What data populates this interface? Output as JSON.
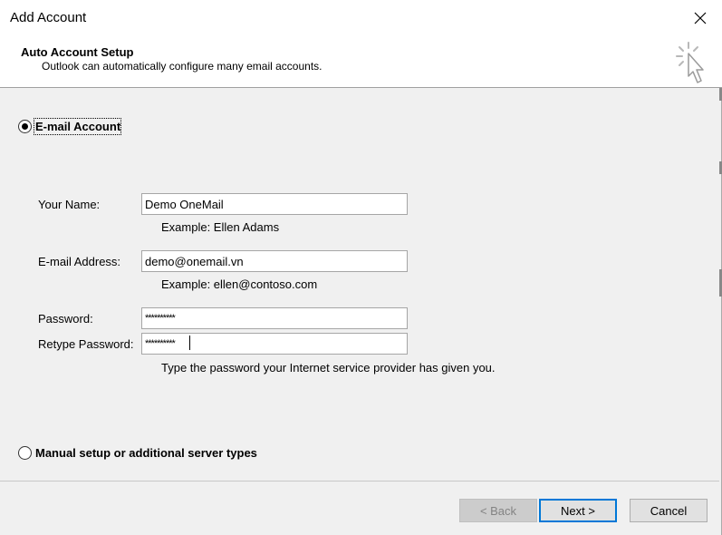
{
  "window": {
    "title": "Add Account",
    "close_icon": "close-icon"
  },
  "header": {
    "title": "Auto Account Setup",
    "subtitle": "Outlook can automatically configure many email accounts.",
    "icon": "wizard-cursor-icon"
  },
  "email_account": {
    "label": "E-mail Account",
    "selected": true,
    "fields": {
      "name": {
        "label": "Your Name:",
        "value": "Demo OneMail",
        "hint": "Example: Ellen Adams"
      },
      "email": {
        "label": "E-mail Address:",
        "value": "demo@onemail.vn",
        "hint": "Example: ellen@contoso.com"
      },
      "password": {
        "label": "Password:",
        "value": "**********"
      },
      "retype_password": {
        "label": "Retype Password:",
        "value": "**********"
      },
      "password_hint": "Type the password your Internet service provider has given you."
    }
  },
  "manual_setup": {
    "label": "Manual setup or additional server types",
    "selected": false
  },
  "buttons": {
    "back": "< Back",
    "next": "Next >",
    "cancel": "Cancel"
  },
  "colors": {
    "accent": "#0078d7",
    "panel": "#f0f0f0",
    "header_bg": "#ffffff"
  }
}
